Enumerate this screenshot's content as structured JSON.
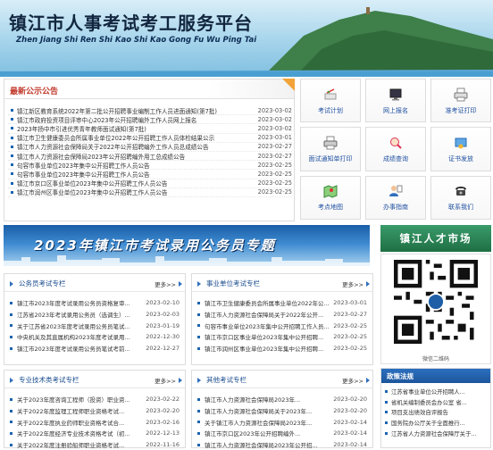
{
  "header": {
    "title": "镇江市人事考试考工服务平台",
    "subtitle": "Zhen Jiang Shi Ren Shi Kao Shi Kao Gong Fu Wu Ping Tai"
  },
  "notice": {
    "title": "最新公示公告",
    "items": [
      {
        "text": "镇江新区教育系统2022年第二批公开招聘事业编制工作人员进面通知(第7批)",
        "date": "2023-03-02"
      },
      {
        "text": "镇江市政府投资项目评审中心2023年公开招聘编外工作人员网上报名",
        "date": "2023-03-02"
      },
      {
        "text": "2023年扬中市引进优秀青年教师面试通知(第7批)",
        "date": "2023-03-02"
      },
      {
        "text": "镇江市卫生健康委员会所属事业单位2022年公开招聘工作人员体检结果公示",
        "date": "2023-03-01"
      },
      {
        "text": "镇江市人力资源社会保障局关于2022年公开招聘编外工作人员总成绩公告",
        "date": "2023-02-27"
      },
      {
        "text": "镇江市人力资源社会保障局2023年公开招聘编外用工总成绩公告",
        "date": "2023-02-27"
      },
      {
        "text": "句容市事业单位2023年集中公开招聘工作人员公告",
        "date": "2023-02-25"
      },
      {
        "text": "句容市事业单位2023年集中公开招聘工作人员公告",
        "date": "2023-02-25"
      },
      {
        "text": "镇江市京口区事业单位2023年集中公开招聘工作人员公告",
        "date": "2023-02-25"
      },
      {
        "text": "镇江市润州区事业单位2023年集中公开招聘工作人员公告",
        "date": "2023-02-25"
      }
    ]
  },
  "quick_links": [
    {
      "label": "考试计划",
      "icon": "exam-plan-icon"
    },
    {
      "label": "网上报名",
      "icon": "online-signup-icon"
    },
    {
      "label": "准考证打印",
      "icon": "admission-print-icon"
    },
    {
      "label": "面试通知单打印",
      "icon": "interview-print-icon"
    },
    {
      "label": "成绩查询",
      "icon": "score-query-icon"
    },
    {
      "label": "证书发放",
      "icon": "certificate-icon"
    },
    {
      "label": "考点地图",
      "icon": "map-icon"
    },
    {
      "label": "办事指南",
      "icon": "guide-icon"
    },
    {
      "label": "联系我们",
      "icon": "phone-icon"
    }
  ],
  "promo": {
    "title": "2023年镇江市考试录用公务员专题"
  },
  "talent": {
    "title": "镇江人才市场",
    "qr_caption": "微信二维码"
  },
  "boxes": [
    {
      "title": "公务员考试专栏",
      "more": "更多>>",
      "items": [
        {
          "text": "镇江市2023年度考试录用公务员资格复审...",
          "date": "2023-02-10"
        },
        {
          "text": "江苏省2023年考试录用公务员（选调生）...",
          "date": "2023-02-03"
        },
        {
          "text": "关于江苏省2023年度考试录用公务员笔试...",
          "date": "2023-01-19"
        },
        {
          "text": "中央机关及其直属机构2023年度考试录用...",
          "date": "2022-12-30"
        },
        {
          "text": "镇江市2023年度考试录用公务员笔试考前...",
          "date": "2022-12-27"
        }
      ]
    },
    {
      "title": "事业单位考试专栏",
      "more": "更多>>",
      "items": [
        {
          "text": "镇江市卫生健康委员会所属事业单位2022年公...",
          "date": "2023-03-01"
        },
        {
          "text": "镇江市人力资源社会保障局关于2022年公开...",
          "date": "2023-02-27"
        },
        {
          "text": "句容市事业单位2023年集中公开招聘工作人员...",
          "date": "2023-02-25"
        },
        {
          "text": "镇江市京口区事业单位2023年集中公开招聘...",
          "date": "2023-02-25"
        },
        {
          "text": "镇江市润州区事业单位2023年集中公开招聘...",
          "date": "2023-02-25"
        }
      ]
    },
    {
      "title": "专业技术类考试专栏",
      "more": "更多>>",
      "items": [
        {
          "text": "关于2023年度咨询工程师（投资）职业资...",
          "date": "2023-02-22"
        },
        {
          "text": "关于2022年度监理工程师职业资格考试...",
          "date": "2023-02-20"
        },
        {
          "text": "关于2022年度执业药师职业资格考试合...",
          "date": "2023-02-16"
        },
        {
          "text": "关于2022年度经济专业技术资格考试（初...",
          "date": "2022-12-13"
        },
        {
          "text": "关于2022年度注册验船师职业资格考试...",
          "date": "2022-11-16"
        }
      ]
    },
    {
      "title": "其他考试专栏",
      "more": "更多>>",
      "items": [
        {
          "text": "镇江市人力资源社会保障局2023年...",
          "date": "2023-02-20"
        },
        {
          "text": "镇江市人力资源社会保障局关于2023年...",
          "date": "2023-02-20"
        },
        {
          "text": "关于镇江市人力资源社会保障局2023年...",
          "date": "2023-02-14"
        },
        {
          "text": "镇江市京口区2023年公开招聘编外...",
          "date": "2023-02-14"
        },
        {
          "text": "镇江市人力资源社会保障局2023年公开招...",
          "date": "2023-02-14"
        }
      ]
    }
  ],
  "policy": {
    "title": "政策法规",
    "items": [
      "江苏省事业单位公开招聘人...",
      "省机关编制委员会办公室 省...",
      "项目支出绩效自评报告",
      "国务院办公厅关于全面推行...",
      "江苏省人力资源社会保障厅关于..."
    ]
  }
}
